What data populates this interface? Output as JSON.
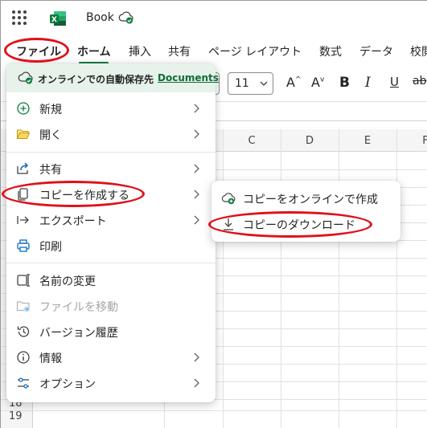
{
  "titlebar": {
    "app_icon": "excel-logo",
    "app_letter": "X",
    "document_name": "Book",
    "save_status_icon": "cloud-saved-icon"
  },
  "tabs": [
    {
      "label": "ファイル"
    },
    {
      "label": "ホーム"
    },
    {
      "label": "挿入"
    },
    {
      "label": "共有"
    },
    {
      "label": "ページ レイアウト"
    },
    {
      "label": "数式"
    },
    {
      "label": "データ"
    },
    {
      "label": "校閲"
    }
  ],
  "ribbon": {
    "font_size": "11",
    "grow_font_label": "A",
    "shrink_font_label": "A",
    "bold_label": "B",
    "italic_label": "I",
    "underline_label": "U",
    "strike_label": "ab"
  },
  "grid": {
    "columns": [
      "C",
      "D",
      "E",
      "F"
    ],
    "rows": [
      "18",
      "19"
    ]
  },
  "file_menu": {
    "autosave_text": "オンラインでの自動保存先",
    "autosave_link": "Documents",
    "items": [
      {
        "label": "新規",
        "icon": "new-icon",
        "has_submenu": true
      },
      {
        "label": "開く",
        "icon": "folder-open-icon",
        "has_submenu": true
      },
      {
        "label": "共有",
        "icon": "share-icon",
        "has_submenu": true
      },
      {
        "label": "コピーを作成する",
        "icon": "copy-icon",
        "has_submenu": true
      },
      {
        "label": "エクスポート",
        "icon": "export-icon",
        "has_submenu": true
      },
      {
        "label": "印刷",
        "icon": "print-icon",
        "has_submenu": false
      },
      {
        "label": "名前の変更",
        "icon": "rename-icon",
        "has_submenu": false
      },
      {
        "label": "ファイルを移動",
        "icon": "move-file-icon",
        "has_submenu": false,
        "disabled": true
      },
      {
        "label": "バージョン履歴",
        "icon": "history-icon",
        "has_submenu": false
      },
      {
        "label": "情報",
        "icon": "info-icon",
        "has_submenu": true
      },
      {
        "label": "オプション",
        "icon": "options-icon",
        "has_submenu": true
      }
    ]
  },
  "submenu": {
    "items": [
      {
        "label": "コピーをオンラインで作成",
        "icon": "cloud-add-icon"
      },
      {
        "label": "コピーのダウンロード",
        "icon": "download-icon"
      }
    ]
  },
  "colors": {
    "excel_green": "#107c41",
    "autosave_bg": "#e6f2ea",
    "annotation_red": "#e0101a"
  }
}
